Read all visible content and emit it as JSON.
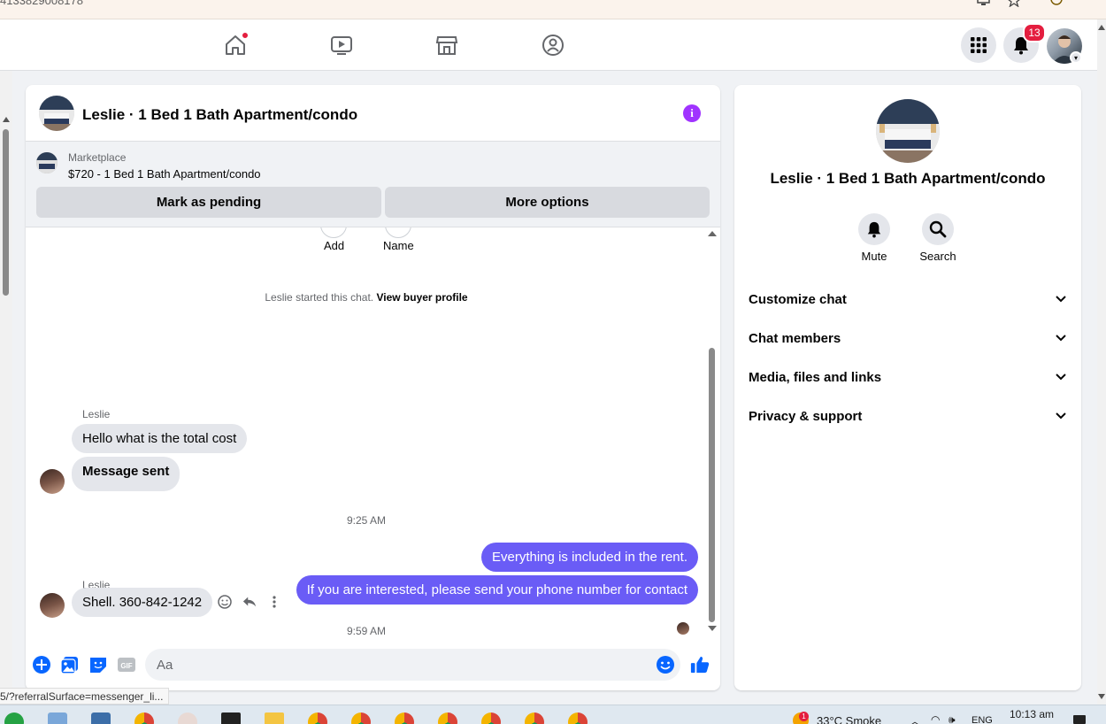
{
  "browser": {
    "url_fragment": "4133829008178"
  },
  "nav": {
    "notification_count": "13"
  },
  "chat": {
    "header_title": "Leslie · 1 Bed 1 Bath Apartment/condo",
    "marketplace_label": "Marketplace",
    "listing_title": "$720 - 1 Bed 1 Bath Apartment/condo",
    "mark_pending_label": "Mark as pending",
    "more_options_label": "More options",
    "quick_actions": [
      {
        "label": "Add"
      },
      {
        "label": "Name"
      }
    ],
    "system_message": {
      "text": "Leslie started this chat.",
      "link": "View buyer profile"
    },
    "messages": [
      {
        "sender": "Leslie",
        "text": "Hello what is the total cost"
      },
      {
        "text": "Message sent"
      },
      {
        "timestamp": "9:25 AM"
      },
      {
        "text": "Everything is included in the rent."
      },
      {
        "text": "If you are interested, please send your phone number for contact"
      },
      {
        "timestamp": "9:59 AM"
      },
      {
        "sender": "Leslie",
        "text": "Shell. 360-842-1242"
      }
    ],
    "composer_placeholder": "Aa"
  },
  "info_panel": {
    "title": "Leslie · 1 Bed 1 Bath Apartment/condo",
    "actions": [
      {
        "label": "Mute",
        "icon": "bell-icon"
      },
      {
        "label": "Search",
        "icon": "search-icon"
      }
    ],
    "sections": [
      {
        "label": "Customize chat"
      },
      {
        "label": "Chat members"
      },
      {
        "label": "Media, files and links"
      },
      {
        "label": "Privacy & support"
      }
    ]
  },
  "status_bar": {
    "link_preview": "5/?referralSurface=messenger_li..."
  },
  "taskbar": {
    "weather": "33°C Smoke",
    "language": "ENG",
    "time": "10:13 am",
    "weather_badge": "1"
  },
  "colors": {
    "accent": "#6a5cf6",
    "fb_blue": "#0866ff",
    "notification_red": "#e41e3f",
    "info_purple": "#a033ff"
  }
}
